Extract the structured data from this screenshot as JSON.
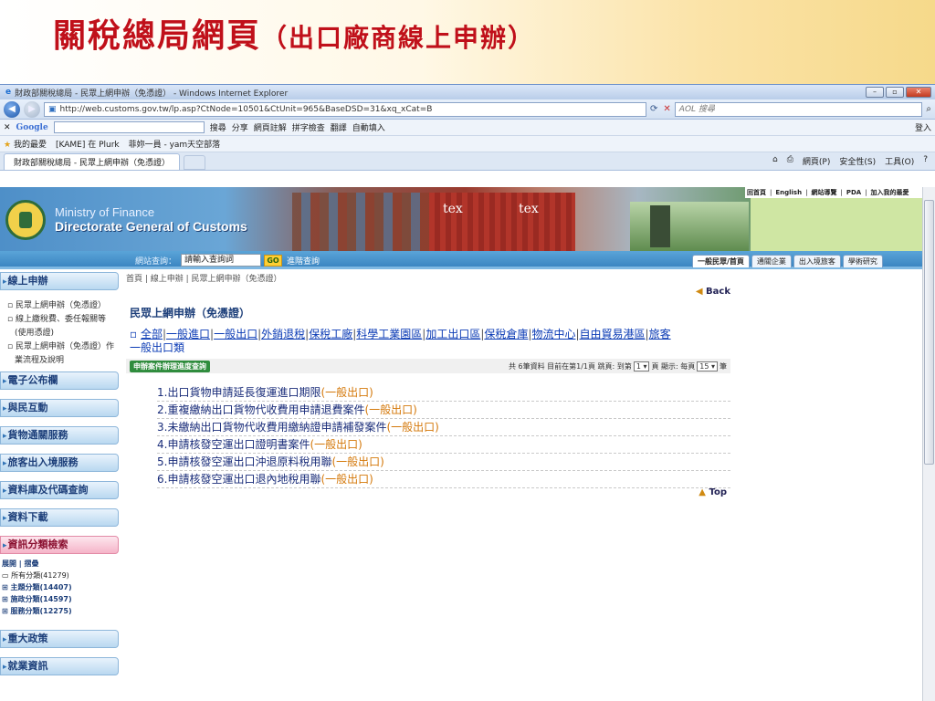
{
  "slide_title": "關稅總局網頁",
  "slide_subtitle": "（出口廠商線上申辦）",
  "window_title": "財政部關稅總局 - 民眾上網申辦（免憑證） - Windows Internet Explorer",
  "url": "http://web.customs.gov.tw/lp.asp?CtNode=10501&CtUnit=965&BaseDSD=31&xq_xCat=B",
  "search_placeholder": "AOL 搜尋",
  "google_label": "Google",
  "toolbar": {
    "g_search": "搜尋",
    "share": "分享",
    "bookmark": "網頁註解",
    "spell": "拼字檢查",
    "translate": "翻譯",
    "autofill": "自動填入",
    "login": "登入"
  },
  "favorites": {
    "fav": "我的最愛",
    "link1": "[KAME] 在 Plurk",
    "link2": "菲妳一員 - yam天空部落"
  },
  "tab_label": "財政部關稅總局 - 民眾上網申辦（免憑證）",
  "cmd": {
    "page": "網頁(P)",
    "safety": "安全性(S)",
    "tools": "工具(O)"
  },
  "site": {
    "mof_line1": "Ministry of Finance",
    "mof_line2": "Directorate General of Customs",
    "tex1": "tex",
    "tex2": "tex",
    "toplinks": [
      "回首頁",
      "English",
      "網站導覽",
      "PDA",
      "加入我的最愛"
    ],
    "search_label": "網站查詢：",
    "search_value": "請輸入查詢詞",
    "go": "GO",
    "advanced": "進階查詢",
    "nav_tabs": [
      "一般民眾/首頁",
      "通關企業",
      "出入境旅客",
      "學術研究"
    ]
  },
  "sidebar": {
    "online": "線上申辦",
    "online_items": [
      "民眾上網申辦（免憑證）",
      "線上繳稅費、委任報關等(使用憑證)",
      "民眾上網申辦（免憑證）作業流程及說明"
    ],
    "sections": [
      "電子公布欄",
      "與民互動",
      "貨物通關服務",
      "旅客出入境服務",
      "資料庫及代碼查詢",
      "資料下載"
    ],
    "classified": "資訊分類檢索",
    "tree_head": "展開 | 摺疊",
    "tree": [
      "所有分類(41279)",
      "主題分類(14407)",
      "施政分類(14597)",
      "服務分類(12275)"
    ],
    "bottom": [
      "重大政策",
      "就業資訊"
    ]
  },
  "content": {
    "breadcrumb": "首頁 | 線上申辦 | 民眾上網申辦（免憑證）",
    "back": "Back",
    "top": "Top",
    "title": "民眾上網申辦（免憑證）",
    "categories": [
      "全部",
      "一般進口",
      "一般出口",
      "外銷退稅",
      "保稅工廠",
      "科學工業園區",
      "加工出口區",
      "保稅倉庫",
      "物流中心",
      "自由貿易港區",
      "旅客"
    ],
    "category_current": "一般出口類",
    "progress_btn": "申辦案件辦理進度查詢",
    "pager_text": "共 6筆資料  目前在第1/1頁  跳頁: 到第",
    "pager_page": "1",
    "pager_page_suffix": "頁  顯示: 每頁",
    "pager_size": "15",
    "pager_size_suffix": "筆",
    "items": [
      {
        "text": "1.出口貨物申請延長復運進口期限",
        "tag": "(一般出口)"
      },
      {
        "text": "2.重複繳納出口貨物代收費用申請退費案件",
        "tag": "(一般出口)"
      },
      {
        "text": "3.未繳納出口貨物代收費用繳納證申請補發案件",
        "tag": "(一般出口)"
      },
      {
        "text": "4.申請核發空運出口證明書案件",
        "tag": "(一般出口)"
      },
      {
        "text": "5.申請核發空運出口沖退原料稅用聯",
        "tag": "(一般出口)"
      },
      {
        "text": "6.申請核發空運出口退內地稅用聯",
        "tag": "(一般出口)"
      }
    ]
  }
}
